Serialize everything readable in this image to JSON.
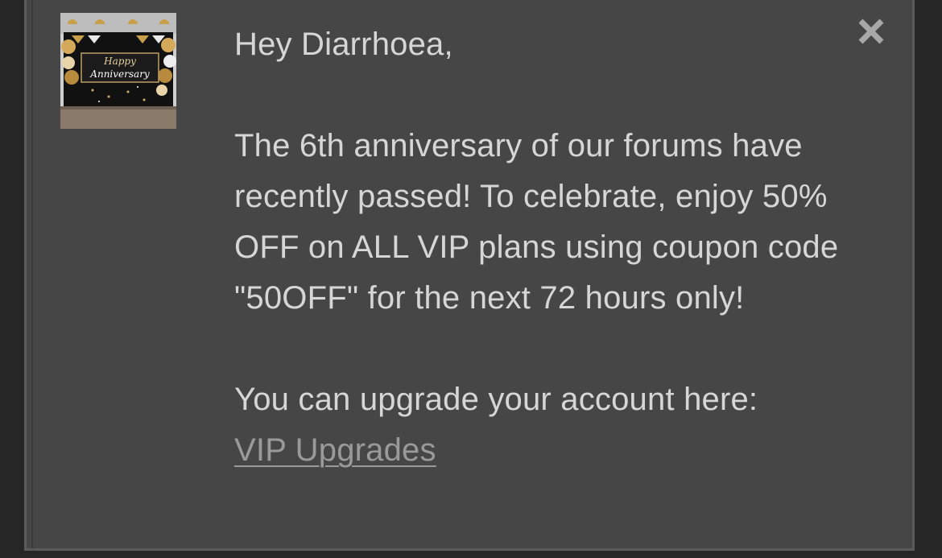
{
  "notice": {
    "image_alt": "Happy Anniversary banner",
    "image_text_line1": "Happy",
    "image_text_line2": "Anniversary",
    "greeting": "Hey Diarrhoea,",
    "body": "The 6th anniversary of our forums have recently passed! To celebrate, enjoy 50% OFF on ALL VIP plans using coupon code \"50OFF\" for the next 72 hours only!",
    "upgrade_text": "You can upgrade your account here:",
    "upgrade_link": "VIP Upgrades",
    "close_icon": "close-icon"
  },
  "colors": {
    "page_bg": "#262626",
    "notice_bg": "#464646",
    "text": "#d6d6d6",
    "link": "#9a9a9a",
    "close": "#a8a8a8"
  }
}
